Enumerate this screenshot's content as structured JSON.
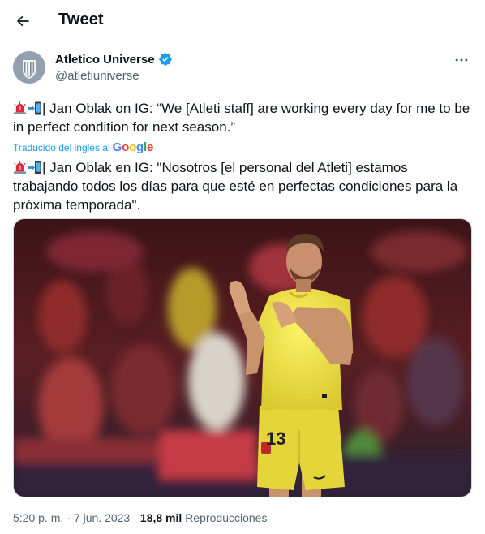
{
  "header": {
    "title": "Tweet"
  },
  "author": {
    "name": "Atletico Universe",
    "handle": "@atletiuniverse"
  },
  "tweet": {
    "original_text": "| Jan Oblak on IG: “We [Atleti staff] are working every day for me to be in perfect condition for next season.”",
    "translation_label": "Traducido del inglés al",
    "translation_provider": "Google",
    "translated_text": "| Jan Oblak en IG: \"Nosotros [el personal del Atleti] estamos trabajando todos los días para que esté en perfectas condiciones para la próxima temporada\".",
    "jersey_number": "13"
  },
  "meta": {
    "time": "5:20 p. m.",
    "sep1": "·",
    "date": "7 jun. 2023",
    "sep2": "·",
    "views_count": "18,8 mil",
    "views_label": "Reproducciones"
  },
  "colors": {
    "accent": "#1d9bf0",
    "secondary_text": "#536471",
    "jersey": "#f2e648"
  },
  "icons": [
    "back-arrow-icon",
    "verified-badge-icon",
    "more-options-icon",
    "rotating-light-icon",
    "mobile-arrow-icon"
  ]
}
